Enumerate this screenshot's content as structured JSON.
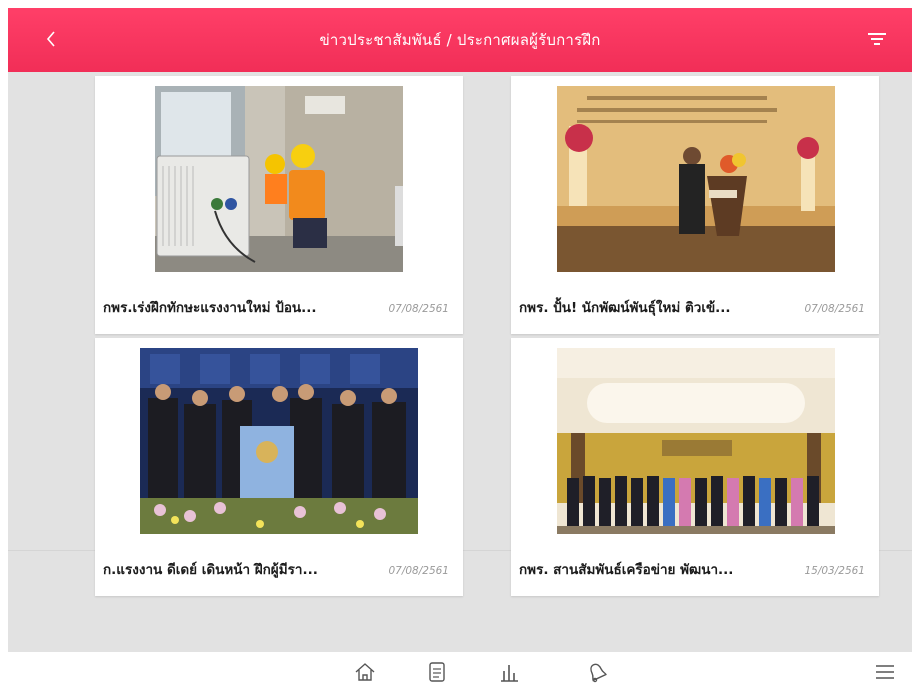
{
  "header": {
    "title": "ข่าวประชาสัมพันธ์ / ประกาศผลผู้รับการฝึก",
    "back_icon": "chevron-left-icon",
    "filter_icon": "filter-icon",
    "background": "#f12e57"
  },
  "news": [
    {
      "title": "กพร.เร่งฝึกทักษะแรงงานใหม่ ป้อน...",
      "date": "07/08/2561",
      "image": "workers-repairing-air-conditioner-photo"
    },
    {
      "title": "กพร. ปั้น! นักพัฒน์พันธุ์ใหม่ ติวเข้...",
      "date": "07/08/2561",
      "image": "speaker-at-podium-photo"
    },
    {
      "title": "ก.แรงงาน ดีเดย์ เดินหน้า ฝึกผู้มีรา...",
      "date": "07/08/2561",
      "image": "officials-group-stage-photo"
    },
    {
      "title": "กพร. สานสัมพันธ์เครือข่าย พัฒนา...",
      "date": "15/03/2561",
      "image": "group-photo-ballroom-photo"
    }
  ],
  "bottom_nav": {
    "items": [
      "home-icon",
      "document-icon",
      "chart-icon",
      "bell-icon"
    ],
    "menu_icon": "hamburger-menu-icon"
  }
}
